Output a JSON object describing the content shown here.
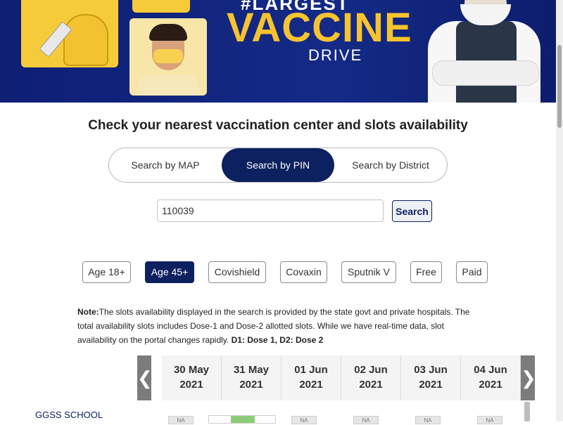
{
  "banner": {
    "hashtag": "#LARGEST",
    "title": "VACCINE",
    "subtitle": "DRIVE"
  },
  "heading": "Check your nearest vaccination center and slots availability",
  "search_tabs": [
    {
      "label": "Search by MAP",
      "active": false
    },
    {
      "label": "Search by PIN",
      "active": true
    },
    {
      "label": "Search by District",
      "active": false
    }
  ],
  "pin_search": {
    "value": "110039",
    "button_label": "Search"
  },
  "filters": [
    {
      "label": "Age 18+",
      "active": false
    },
    {
      "label": "Age 45+",
      "active": true
    },
    {
      "label": "Covishield",
      "active": false
    },
    {
      "label": "Covaxin",
      "active": false
    },
    {
      "label": "Sputnik V",
      "active": false
    },
    {
      "label": "Free",
      "active": false
    },
    {
      "label": "Paid",
      "active": false
    }
  ],
  "note": {
    "label": "Note:",
    "text": "The slots availability displayed in the search is provided by the state govt and private hospitals. The total availability slots includes Dose-1 and Dose-2 allotted slots. While we have real-time data, slot availability on the portal changes rapidly.",
    "dose_legend": "D1: Dose 1, D2: Dose 2"
  },
  "dates": [
    {
      "day": "30 May",
      "year": "2021"
    },
    {
      "day": "31 May",
      "year": "2021"
    },
    {
      "day": "01 Jun",
      "year": "2021"
    },
    {
      "day": "02 Jun",
      "year": "2021"
    },
    {
      "day": "03 Jun",
      "year": "2021"
    },
    {
      "day": "04 Jun",
      "year": "2021"
    }
  ],
  "date_nav": {
    "prev": "❮",
    "next": "❯"
  },
  "center": {
    "name": "GGSS SCHOOL",
    "na_label": "NA"
  },
  "colors": {
    "brand_navy": "#0d2160",
    "banner_blue": "#142a86",
    "vaccine_yellow": "#f7c32e",
    "slot_green": "#8dcc78"
  }
}
